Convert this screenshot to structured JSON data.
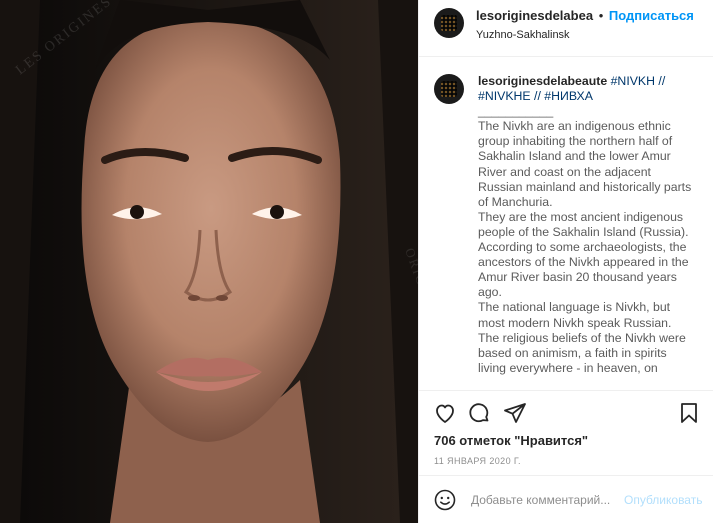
{
  "photo": {
    "watermark_top": "LES ORIGINES DE LA BEAUTE",
    "watermark_right": "ORIGINES DE LA BEAUTE"
  },
  "header": {
    "username": "lesoriginesdelabea",
    "dot": "•",
    "follow_label": "Подписаться",
    "location": "Yuzhno-Sakhalinsk"
  },
  "caption": {
    "username": "lesoriginesdelabeaute",
    "hashtags_line1": "#NIVKH //",
    "hashtags_line2": "#NIVKHE // #НИВХА",
    "separator": "___________",
    "body": "The Nivkh are an indigenous ethnic group inhabiting the northern half of Sakhalin Island and the lower Amur River and coast on the adjacent Russian mainland and historically parts of Manchuria.\nThey are the most ancient indigenous people of the Sakhalin Island (Russia). According to some archaeologists, the ancestors of the Nivkh appeared in the Amur River basin 20 thousand years ago.\nThe national language is Nivkh, but most modern Nivkh speak Russian.\nThe religious beliefs of the Nivkh were based on animism, a faith in spirits living everywhere - in heaven, on"
  },
  "actions": {
    "like_icon": "heart-icon",
    "comment_icon": "comment-icon",
    "share_icon": "paper-plane-icon",
    "save_icon": "bookmark-icon"
  },
  "likes_text": "706 отметок \"Нравится\"",
  "date_text": "11 ЯНВАРЯ 2020 Г.",
  "comment_box": {
    "placeholder": "Добавьте комментарий...",
    "publish_label": "Опубликовать"
  },
  "colors": {
    "link_blue": "#0095f6",
    "hashtag": "#00376b",
    "publish_disabled": "#b2dffc",
    "muted": "#8e8e8e"
  }
}
